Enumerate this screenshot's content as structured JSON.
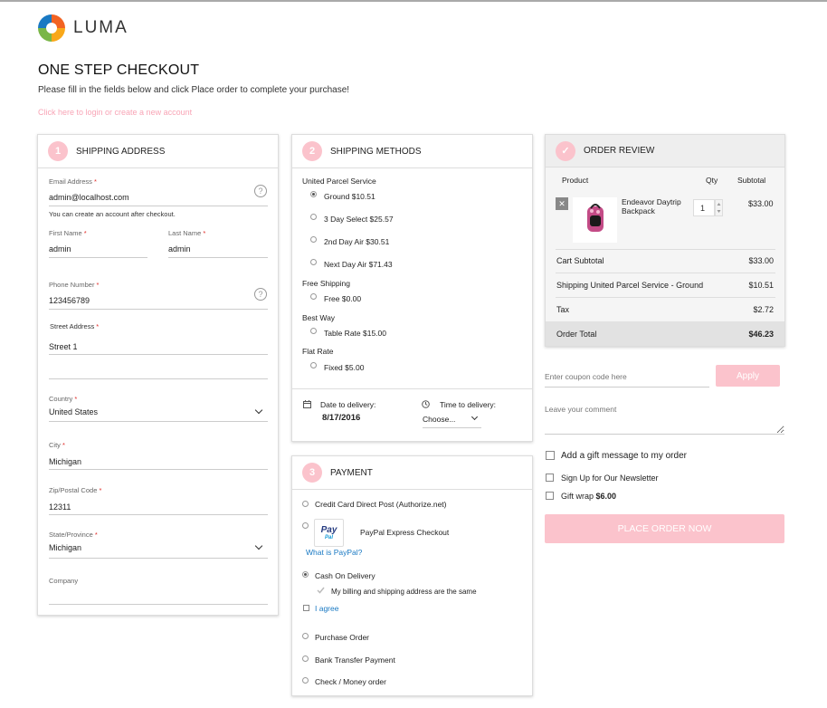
{
  "brand": {
    "name": "LUMA"
  },
  "page": {
    "title": "ONE STEP CHECKOUT",
    "subtitle": "Please fill in the fields below and click Place order to complete your purchase!",
    "login_link": "Click here to login or create a new account"
  },
  "shipping_address": {
    "step": "1",
    "title": "SHIPPING ADDRESS",
    "email_label": "Email Address",
    "email_value": "admin@localhost.com",
    "email_hint": "You can create an account after checkout.",
    "first_name_label": "First Name",
    "first_name_value": "admin",
    "last_name_label": "Last Name",
    "last_name_value": "admin",
    "phone_label": "Phone Number",
    "phone_value": "123456789",
    "street_label": "Street Address",
    "street_value": "Street 1",
    "country_label": "Country",
    "country_value": "United States",
    "city_label": "City",
    "city_value": "Michigan",
    "zip_label": "Zip/Postal Code",
    "zip_value": "12311",
    "state_label": "State/Province",
    "state_value": "Michigan",
    "company_label": "Company",
    "required_mark": "*",
    "help_mark": "?"
  },
  "shipping_methods": {
    "step": "2",
    "title": "SHIPPING METHODS",
    "groups": [
      {
        "name": "United Parcel Service",
        "options": [
          "Ground $10.51",
          "3 Day Select $25.57",
          "2nd Day Air $30.51",
          "Next Day Air $71.43"
        ]
      },
      {
        "name": "Free Shipping",
        "options": [
          "Free $0.00"
        ]
      },
      {
        "name": "Best Way",
        "options": [
          "Table Rate $15.00"
        ]
      },
      {
        "name": "Flat Rate",
        "options": [
          "Fixed $5.00"
        ]
      }
    ],
    "date_label": "Date to delivery:",
    "date_value": "8/17/2016",
    "time_label": "Time to delivery:",
    "time_value": "Choose..."
  },
  "payment": {
    "step": "3",
    "title": "PAYMENT",
    "options": {
      "credit_card": "Credit Card Direct Post (Authorize.net)",
      "paypal": "PayPal Express Checkout",
      "paypal_logo_top": "Pay",
      "paypal_logo_bottom": "Pal",
      "what_is_paypal": "What is PayPal?",
      "cod": "Cash On Delivery",
      "same_address": "My billing and shipping address are the same",
      "agree": "I agree",
      "purchase_order": "Purchase Order",
      "bank_transfer": "Bank Transfer Payment",
      "check_money": "Check / Money order"
    }
  },
  "order_review": {
    "title": "ORDER REVIEW",
    "check_mark": "✓",
    "col_product": "Product",
    "col_qty": "Qty",
    "col_subtotal": "Subtotal",
    "item_name": "Endeavor Daytrip Backpack",
    "item_qty": "1",
    "item_subtotal": "$33.00",
    "remove_icon": "✕",
    "rows": [
      {
        "label": "Cart Subtotal",
        "value": "$33.00"
      },
      {
        "label": "Shipping United Parcel Service - Ground",
        "value": "$10.51"
      },
      {
        "label": "Tax",
        "value": "$2.72"
      }
    ],
    "total_label": "Order Total",
    "total_value": "$46.23"
  },
  "extras": {
    "coupon_placeholder": "Enter coupon code here",
    "apply_label": "Apply",
    "comment_placeholder": "Leave your comment",
    "gift_message": "Add a gift message to my order",
    "newsletter": "Sign Up for Our Newsletter",
    "gift_wrap": "Gift wrap",
    "gift_wrap_price": "$6.00",
    "place_order": "PLACE ORDER NOW"
  },
  "colors": {
    "accent_pink": "#fbc3cc",
    "link_blue": "#1979c3"
  }
}
